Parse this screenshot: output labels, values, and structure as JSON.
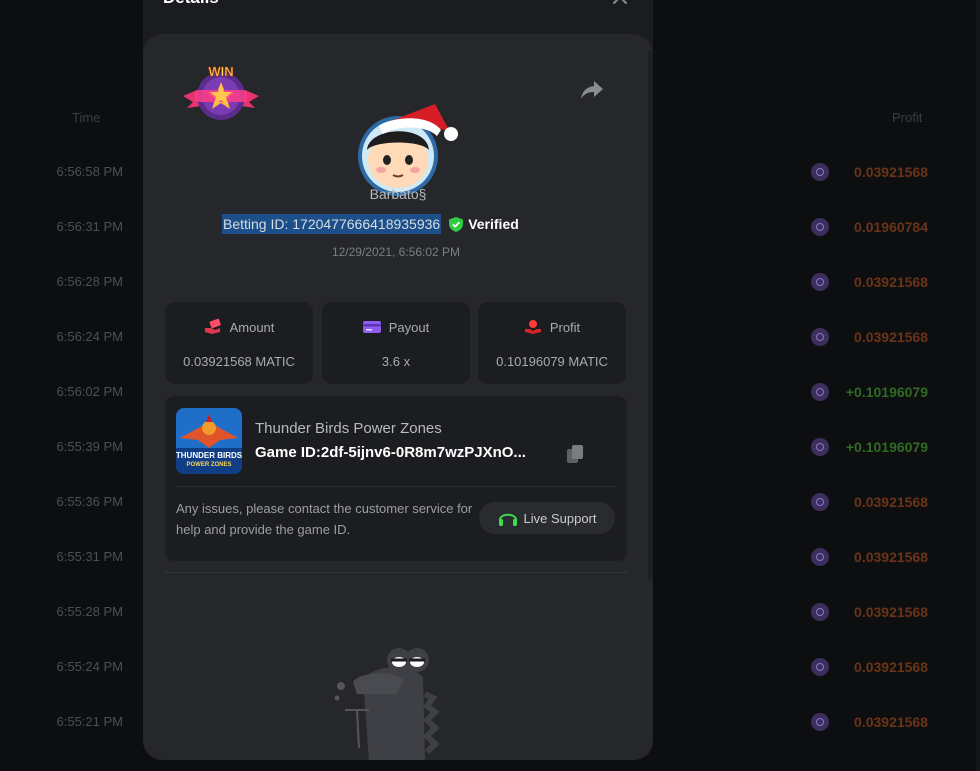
{
  "background": {
    "col_time": "Time",
    "col_profit": "Profit",
    "rows": [
      {
        "time": "6:56:58 PM",
        "profit": "0.03921568",
        "kind": "loss"
      },
      {
        "time": "6:56:31 PM",
        "profit": "0.01960784",
        "kind": "loss"
      },
      {
        "time": "6:56:28 PM",
        "profit": "0.03921568",
        "kind": "loss"
      },
      {
        "time": "6:56:24 PM",
        "profit": "0.03921568",
        "kind": "loss"
      },
      {
        "time": "6:56:02 PM",
        "profit": "+0.10196079",
        "kind": "win"
      },
      {
        "time": "6:55:39 PM",
        "profit": "+0.10196079",
        "kind": "win"
      },
      {
        "time": "6:55:36 PM",
        "profit": "0.03921568",
        "kind": "loss"
      },
      {
        "time": "6:55:31 PM",
        "profit": "0.03921568",
        "kind": "loss"
      },
      {
        "time": "6:55:28 PM",
        "profit": "0.03921568",
        "kind": "loss"
      },
      {
        "time": "6:55:24 PM",
        "profit": "0.03921568",
        "kind": "loss"
      },
      {
        "time": "6:55:21 PM",
        "profit": "0.03921568",
        "kind": "loss"
      }
    ]
  },
  "modal": {
    "title": "Details",
    "badge_text": "WIN",
    "username": "Barbato§",
    "betting_id": "Betting ID: 1720477666418935936",
    "verified": "Verified",
    "date": "12/29/2021, 6:56:02 PM",
    "stats": {
      "amount_label": "Amount",
      "amount_value": "0.03921568 MATIC",
      "payout_label": "Payout",
      "payout_value": "3.6 x",
      "profit_label": "Profit",
      "profit_value": "0.10196079 MATIC"
    },
    "game": {
      "name": "Thunder Birds Power Zones",
      "id": "Game ID:2df-5ijnv6-0R8m7wzPJXnO...",
      "thumb_line1": "THUNDER BIRDS",
      "thumb_line2": "POWER ZONES",
      "issue_text": "Any issues, please contact the customer service for help and provide the game ID.",
      "support_label": "Live Support"
    }
  },
  "colors": {
    "loss": "#6b3418",
    "win": "#2f6b24",
    "accent_green": "#3ddc4a",
    "selection": "#1c4f8a"
  }
}
